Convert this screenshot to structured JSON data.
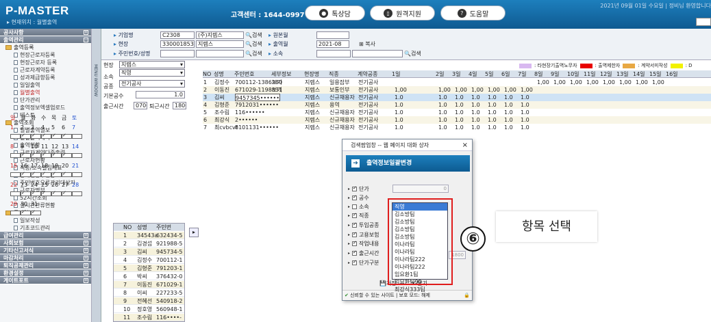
{
  "header": {
    "logo": "P-MASTER",
    "location": "▸ 현재위치 : 월별출역",
    "center": "고객센터 : 1644-0997",
    "btn_chat": "톡상담",
    "btn_remote": "원격지원",
    "btn_help": "도움말",
    "date": "2021년 09월 01일 수요일 | 정비님 환영합니다"
  },
  "sidebar": {
    "sec1": "공사사항",
    "sec2": "출역관리",
    "grp1": "출역등록",
    "items1": [
      "현장근로자등록",
      "현장근로자 등록",
      "근로자계약등록",
      "성과제급항등록",
      "일일출역",
      "월별출역",
      "단가관리",
      "출역정보엑셀업로드",
      "테스트"
    ],
    "grp2": "출역조회",
    "items2": [
      "일별출역일보",
      "일별출역내역",
      "출역현황",
      "근로자계약다중출력",
      "근로자현황",
      "직종/소속별집계표",
      "장애인공수현황",
      "주민번호오류관리대상자",
      "근로자명부",
      "52시간조회",
      "실시간관류현황"
    ],
    "grp3": "공사일보",
    "items3": [
      "일보작성",
      "기초코드관리"
    ],
    "secs": [
      "급여관리",
      "사회보험",
      "기타신고서식",
      "마감처리",
      "퇴직공제관리",
      "환경설정",
      "게이트포트"
    ]
  },
  "vtab": "MENU WINDOW",
  "form": {
    "l_site": "기업명",
    "v_code": "C2308",
    "v_name": "(주)지렙스",
    "l_field": "현장",
    "v_fcode": "3300018537",
    "v_fname": "지렙스",
    "l_resident": "주민번호/성명",
    "l_month": "원본월",
    "l_work_month": "출역월",
    "v_month": "2021-08",
    "l_team": "소속",
    "search": "검색",
    "copy": "복사"
  },
  "legend": {
    "a": ": 타현장기출역노무자",
    "b": ": 출역제한자",
    "c": ": 계약서미작성"
  },
  "colors": {
    "a": "#d8b8f0",
    "b": "#e80000",
    "c": "#e8a844",
    "d": "#f2f200"
  },
  "left": {
    "l_site": "현장",
    "v_site": "지렙스",
    "l_team": "소속",
    "v_team": "직영",
    "l_type": "공종",
    "v_type": "전기공사",
    "l_base": "기본공수",
    "v_base": "1.0",
    "l_time": "출근시간",
    "v_in": "0700",
    "l_out": "퇴근시간",
    "v_out": "1800"
  },
  "cal": {
    "days": [
      "일",
      "월",
      "화",
      "수",
      "목",
      "금",
      "토"
    ],
    "rows": [
      [
        "",
        "",
        "",
        "",
        "",
        "",
        ""
      ],
      [
        "1",
        "2",
        "3",
        "4",
        "5",
        "6",
        "7"
      ],
      [
        "8",
        "9",
        "10",
        "11",
        "12",
        "13",
        "14"
      ],
      [
        "15",
        "16",
        "17",
        "18",
        "19",
        "20",
        "21"
      ],
      [
        "22",
        "23",
        "24",
        "25",
        "26",
        "27",
        "28"
      ],
      [
        "29",
        "30",
        "31",
        "",
        "",
        "",
        ""
      ]
    ]
  },
  "grid": {
    "headers": [
      "NO",
      "성명",
      "주민번호",
      "세부정보",
      "현장명",
      "직종",
      "계약공종",
      "1일",
      "2일",
      "3일",
      "4일",
      "5일",
      "6일",
      "7일",
      "8일",
      "9일",
      "10일",
      "11일",
      "12일",
      "13일",
      "14일",
      "15일",
      "16일"
    ],
    "rows": [
      [
        "1",
        "김정수",
        "700112-1386280",
        "보기",
        "지렙스",
        "일용잡부",
        "전기공사"
      ],
      [
        "2",
        "이동진",
        "671029-1198831",
        "보기",
        "지렙스",
        "보통인부",
        "전기공사"
      ],
      [
        "3",
        "김씨",
        "9457345••••••",
        "",
        "지렙스",
        "신규채용자",
        "전기공사"
      ],
      [
        "4",
        "김형준",
        "7912031••••••",
        "",
        "지렙스",
        "용역",
        "전기공사"
      ],
      [
        "5",
        "조수림",
        "116••••••",
        "",
        "지렙스",
        "신규채용자",
        "전기공사"
      ],
      [
        "6",
        "최강식",
        "2••••••",
        "",
        "지렙스",
        "신규채용자",
        "전기공사"
      ],
      [
        "7",
        "최cvbcvt",
        "8101131••••••",
        "",
        "지렙스",
        "신규채용자",
        "전기공사"
      ]
    ],
    "row2_vals": [
      "1,00",
      "1,00",
      "1,00",
      "1,00",
      "1,00",
      "1,00",
      "1,00"
    ],
    "row1_vals": [
      "1,00",
      "1,00",
      "1,00",
      "1,00",
      "1,00",
      "1,00",
      "1,00",
      "1,00"
    ],
    "other_vals": [
      "1.0",
      "1.0",
      "1.0",
      "1.0",
      "1.0",
      "1.0",
      "1.0"
    ]
  },
  "mini": {
    "headers": [
      "NO",
      "성명",
      "주민번"
    ],
    "rows": [
      [
        "1",
        "34543a",
        "632434-5"
      ],
      [
        "2",
        "김경섭",
        "921988-5"
      ],
      [
        "3",
        "김씨",
        "945734-5"
      ],
      [
        "4",
        "김정수",
        "700112-1"
      ],
      [
        "5",
        "김형준",
        "791203-1"
      ],
      [
        "6",
        "박씨",
        "376432-0"
      ],
      [
        "7",
        "이동진",
        "671029-1"
      ],
      [
        "8",
        "이씨",
        "227233-5"
      ],
      [
        "9",
        "전혜선",
        "540918-2"
      ],
      [
        "10",
        "정호영",
        "560948-1"
      ],
      [
        "11",
        "조수림",
        "116••••-"
      ]
    ]
  },
  "dialog": {
    "title": "검색팝업창 -- 웹 페이지 대화 상자",
    "banner": "출역정보일괄변경",
    "fields": [
      "단가",
      "공수",
      "소속",
      "직종",
      "투입공종",
      "고용보험",
      "작업내용",
      "출근시간",
      "단가구분"
    ],
    "checked": [
      true,
      true,
      false,
      true,
      true,
      true,
      true,
      true,
      true
    ],
    "v_price": "0",
    "v_work": "1.0",
    "v_time": "1800",
    "list": [
      "직영",
      "김소방팀",
      "김소방팀",
      "김소방팀",
      "김소방팀",
      "이나라팀",
      "이나라팀",
      "이나라팀222",
      "이나라팀222",
      "임요환1팀",
      "임요환팀99",
      "최강식333팀"
    ],
    "btn_save": "저장",
    "btn_close": "닫기",
    "footer": "신뢰할 수 있는 사이트 | 보호 모드: 해제"
  },
  "annotation": {
    "step": "⑥",
    "text": "항목 선택"
  }
}
